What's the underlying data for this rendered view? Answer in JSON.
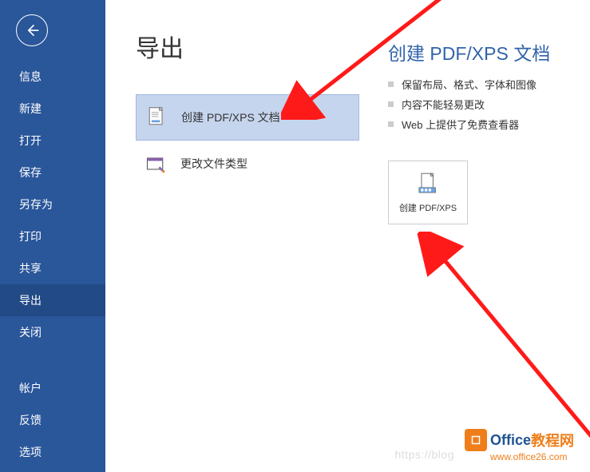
{
  "sidebar": {
    "items": [
      {
        "label": "信息"
      },
      {
        "label": "新建"
      },
      {
        "label": "打开"
      },
      {
        "label": "保存"
      },
      {
        "label": "另存为"
      },
      {
        "label": "打印"
      },
      {
        "label": "共享"
      },
      {
        "label": "导出"
      },
      {
        "label": "关闭"
      }
    ],
    "bottom_items": [
      {
        "label": "帐户"
      },
      {
        "label": "反馈"
      },
      {
        "label": "选项"
      }
    ]
  },
  "main": {
    "title": "导出",
    "options": [
      {
        "label": "创建 PDF/XPS 文档"
      },
      {
        "label": "更改文件类型"
      }
    ]
  },
  "right": {
    "heading": "创建 PDF/XPS 文档",
    "bullets": [
      "保留布局、格式、字体和图像",
      "内容不能轻易更改",
      "Web 上提供了免费查看器"
    ],
    "button_label": "创建 PDF/XPS"
  },
  "watermark": {
    "brand1": "Office",
    "brand2": "教程网",
    "url": "www.office26.com",
    "faint_url": "https://blog"
  }
}
